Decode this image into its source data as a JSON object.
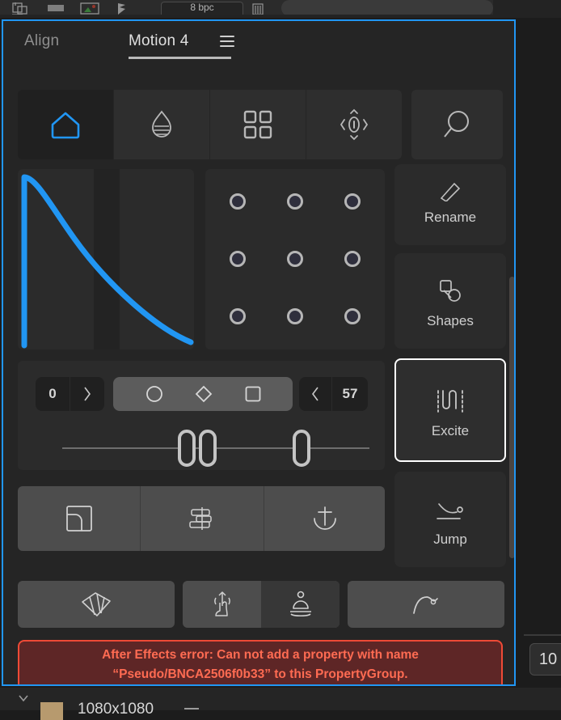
{
  "top_toolbar": {
    "bit_depth_label": "8 bpc",
    "icons": [
      "panel-layout-icon",
      "rectangle-icon",
      "image-thumbnail-icon",
      "snapshot-icon",
      "bit-depth-field",
      "trash-icon"
    ]
  },
  "panel": {
    "tabs": [
      {
        "id": "align",
        "label": "Align",
        "active": false
      },
      {
        "id": "motion4",
        "label": "Motion 4",
        "active": true
      }
    ],
    "menu_icon": "hamburger-menu-icon",
    "toolbar_icons": [
      {
        "id": "home",
        "name": "home-icon",
        "active": true
      },
      {
        "id": "droplet",
        "name": "droplet-lines-icon",
        "active": false
      },
      {
        "id": "grid",
        "name": "grid-four-squares-icon",
        "active": false
      },
      {
        "id": "anchor-move",
        "name": "zero-arrows-icon",
        "active": false
      },
      {
        "id": "search",
        "name": "search-magnifier-icon",
        "active": false
      }
    ],
    "graph": {
      "name": "easing-curve-graph",
      "curve_color": "#2196f3",
      "band_color": "#232323"
    },
    "anchor_grid": {
      "name": "anchor-point-grid",
      "rows": 3,
      "cols": 3,
      "dot_fill": "#2f2f3d",
      "dot_ring": "#b6b6b6"
    },
    "easing_controls": {
      "left_value": "0",
      "left_chevron": "chevron-right-icon",
      "right_chevron": "chevron-left-icon",
      "right_value": "57",
      "shape_options": [
        {
          "id": "circle",
          "name": "circle-icon"
        },
        {
          "id": "diamond",
          "name": "diamond-icon"
        },
        {
          "id": "square",
          "name": "square-icon"
        }
      ],
      "handles": [
        "handle-a",
        "handle-b",
        "handle-c"
      ]
    },
    "wide_buttons": [
      {
        "id": "duplicate",
        "name": "layered-squares-icon"
      },
      {
        "id": "align-layers",
        "name": "align-layers-icon"
      },
      {
        "id": "anchor",
        "name": "anchor-icon"
      }
    ],
    "bottom_buttons": [
      {
        "id": "stagger",
        "name": "fan-spread-icon",
        "active": false
      },
      {
        "id": "pick",
        "name": "pointing-finger-icon",
        "active": false
      },
      {
        "id": "zen",
        "name": "meditation-figure-icon",
        "active": true
      },
      {
        "id": "curve",
        "name": "bezier-curve-icon",
        "active": false
      }
    ],
    "side_buttons": [
      {
        "id": "rename",
        "label": "Rename",
        "icon": "pencil-icon",
        "selected": false
      },
      {
        "id": "shapes",
        "label": "Shapes",
        "icon": "shapes-icon",
        "selected": false
      },
      {
        "id": "excite",
        "label": "Excite",
        "icon": "excite-wave-icon",
        "selected": true
      },
      {
        "id": "jump",
        "label": "Jump",
        "icon": "jump-arc-icon",
        "selected": false
      }
    ],
    "error": {
      "line1": "After Effects error: Can not add a property with name",
      "line2": "“Pseudo/BNCA2506f0b33” to this PropertyGroup.",
      "text_color": "#ff6b52",
      "background_color": "#5e2626"
    }
  },
  "side_field": {
    "value": "10"
  },
  "footer": {
    "comp_size": "1080x1080",
    "swatch_color": "#b79a6e"
  }
}
